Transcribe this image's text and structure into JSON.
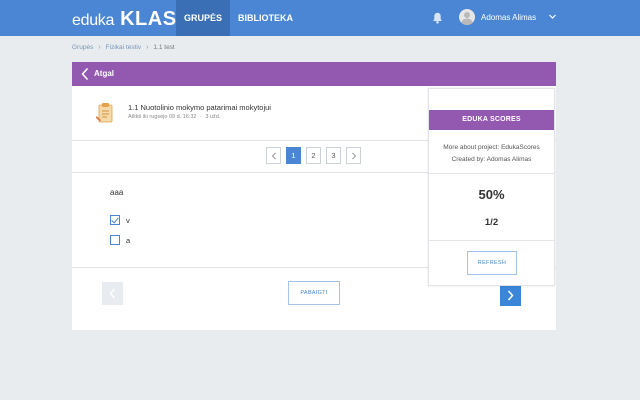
{
  "header": {
    "logo_left": "eduka",
    "logo_right": "KLASĖ",
    "nav": [
      {
        "label": "GRUPĖS",
        "active": true
      },
      {
        "label": "BIBLIOTEKA",
        "active": false
      }
    ],
    "user_name": "Adomas Alimas",
    "icons": {
      "notifications": "bell-icon",
      "menu": "chevron-down-icon"
    }
  },
  "breadcrumb": [
    "Grupės",
    "Fizikai testiv",
    "1.1 test"
  ],
  "card": {
    "back_label": "Atgal",
    "test_title": "1.1 Nuotolinio mokymo patarimai mokytojui",
    "test_meta_date": "Atlikti iki rugsėjo 09 d. 16:32",
    "test_meta_count": "3 užd.",
    "pages": [
      "1",
      "2",
      "3"
    ],
    "active_page": "1",
    "question": "aaa",
    "options": [
      {
        "label": "v",
        "checked": true
      },
      {
        "label": "a",
        "checked": false
      }
    ],
    "finish_label": "PABAIGTI"
  },
  "scores": {
    "title": "EDUKA SCORES",
    "more_label": "More about project: EdukaScores",
    "created_label": "Created by: Adomas Alimas",
    "percent": "50%",
    "fraction": "1/2",
    "refresh_label": "REFRESH"
  },
  "colors": {
    "topbar": "#4a86d4",
    "accent_purple": "#9358b0",
    "primary_blue": "#3b86d8",
    "background": "#e9ecef"
  }
}
